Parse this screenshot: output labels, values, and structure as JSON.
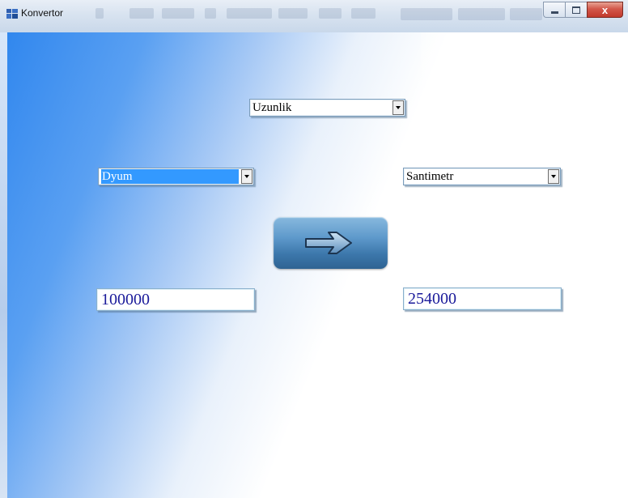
{
  "window": {
    "title": "Konvertor",
    "icon": "app-icon",
    "controls": {
      "minimize": "minimize-icon",
      "maximize": "maximize-icon",
      "close_label": "x"
    }
  },
  "converter": {
    "category": {
      "selected": "Uzunlik"
    },
    "from_unit": {
      "selected": "Dyum"
    },
    "to_unit": {
      "selected": "Santimetr"
    },
    "convert_button": {
      "icon": "arrow-right-icon"
    },
    "input_value": "100000",
    "result_value": "254000"
  },
  "colors": {
    "selection": "#3399ff",
    "value_text": "#1a1a9a",
    "button": "#4a86ba",
    "close_button": "#c94235",
    "gradient_blue": "#2f86ee"
  }
}
